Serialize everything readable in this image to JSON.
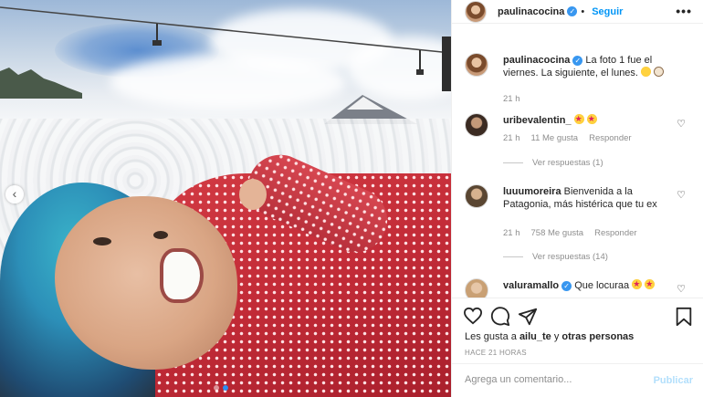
{
  "post": {
    "author": "paulinacocina",
    "follow_label": "Seguir",
    "more_label": "•••",
    "caption": "La foto 1 fue el viernes. La siguiente, el lunes.",
    "caption_time": "21 h"
  },
  "comments": [
    {
      "user": "uribevalentin_",
      "text": "",
      "time": "21 h",
      "likes": "11 Me gusta",
      "reply_label": "Responder",
      "replies_label": "Ver respuestas (1)"
    },
    {
      "user": "luuumoreira",
      "text": "Bienvenida a la Patagonia, más histérica que tu ex",
      "time": "21 h",
      "likes": "758 Me gusta",
      "reply_label": "Responder",
      "replies_label": "Ver respuestas (14)"
    },
    {
      "user": "valuramallo",
      "text": "Que locuraa"
    }
  ],
  "engagement": {
    "liked_by_prefix": "Les gusta a",
    "liked_by_user": "ailu_te",
    "liked_by_conj": "y",
    "liked_by_others": "otras personas",
    "posted_ago": "HACE 21 HORAS"
  },
  "composer": {
    "placeholder": "Agrega un comentario...",
    "publish_label": "Publicar"
  },
  "carousel": {
    "prev_label": "‹",
    "slide_count": 2,
    "active_slide": 1
  },
  "colors": {
    "link_blue": "#0095f6",
    "verified_blue": "#3897f0",
    "publish_disabled": "#b2dffc",
    "jacket_red": "#c22b37",
    "hair_blue": "#2c8fb8"
  },
  "icons": [
    "heart-icon",
    "comment-icon",
    "share-icon",
    "bookmark-icon",
    "verified-badge-icon",
    "more-options-icon",
    "chevron-left-icon"
  ]
}
